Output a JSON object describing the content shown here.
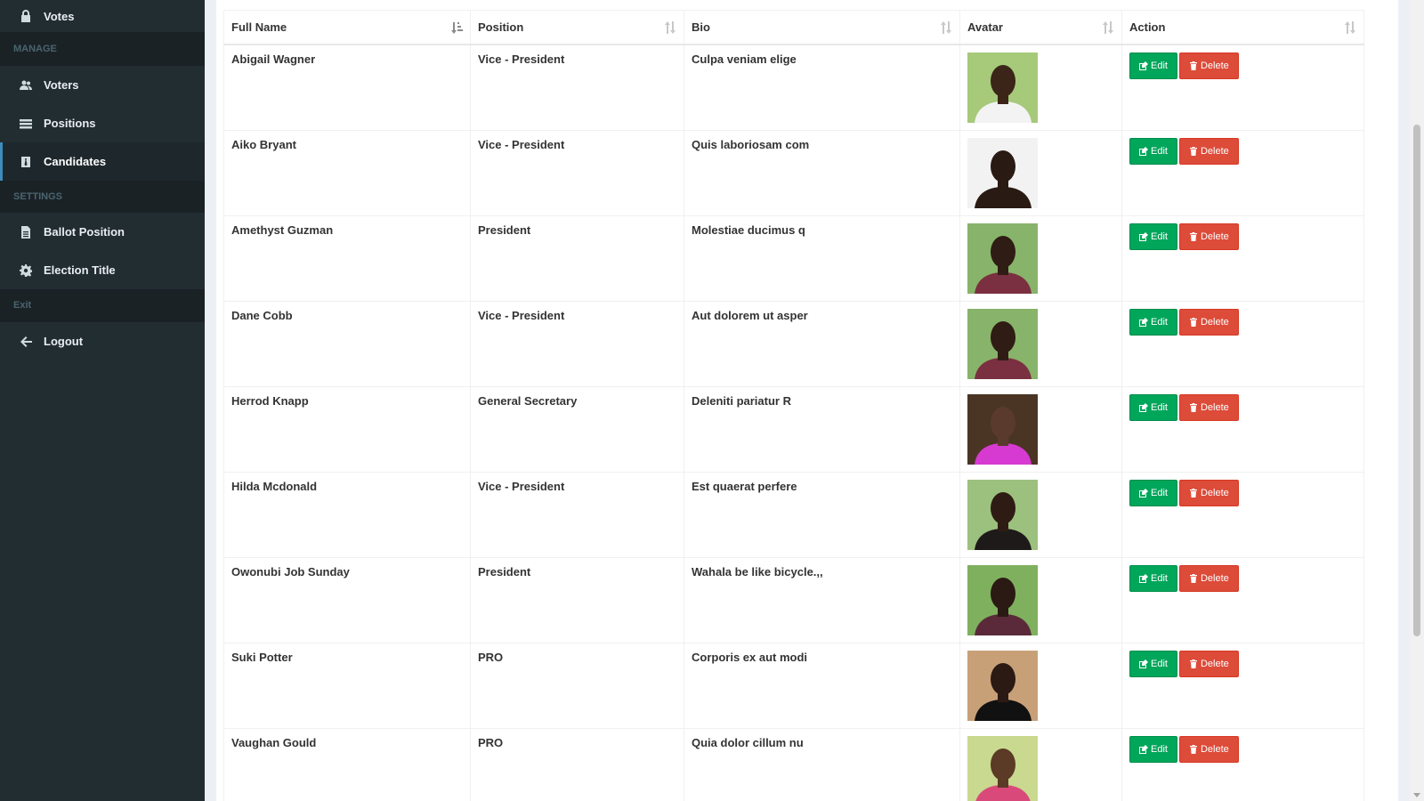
{
  "sidebar": {
    "top_item": {
      "label": "Votes",
      "icon": "lock-icon"
    },
    "sections": [
      {
        "header": "MANAGE",
        "items": [
          {
            "label": "Voters",
            "icon": "users-icon",
            "active": false
          },
          {
            "label": "Positions",
            "icon": "tasks-icon",
            "active": false
          },
          {
            "label": "Candidates",
            "icon": "black-tie-icon",
            "active": true
          }
        ]
      },
      {
        "header": "SETTINGS",
        "items": [
          {
            "label": "Ballot Position",
            "icon": "file-text-icon",
            "active": false
          },
          {
            "label": "Election Title",
            "icon": "cog-icon",
            "active": false
          }
        ]
      },
      {
        "header": "Exit",
        "items": [
          {
            "label": "Logout",
            "icon": "arrow-left-icon",
            "active": false
          }
        ]
      }
    ]
  },
  "table": {
    "columns": [
      "Full Name",
      "Position",
      "Bio",
      "Avatar",
      "Action"
    ],
    "edit_label": "Edit",
    "delete_label": "Delete",
    "rows": [
      {
        "name": "Abigail Wagner",
        "position": "Vice - President",
        "bio": "Culpa veniam elige"
      },
      {
        "name": "Aiko Bryant",
        "position": "Vice - President",
        "bio": "Quis laboriosam com"
      },
      {
        "name": "Amethyst Guzman",
        "position": "President",
        "bio": "Molestiae ducimus q"
      },
      {
        "name": "Dane Cobb",
        "position": "Vice - President",
        "bio": "Aut dolorem ut asper"
      },
      {
        "name": "Herrod Knapp",
        "position": "General Secretary",
        "bio": "Deleniti pariatur R"
      },
      {
        "name": "Hilda Mcdonald",
        "position": "Vice - President",
        "bio": "Est quaerat perfere"
      },
      {
        "name": "Owonubi Job Sunday",
        "position": "President",
        "bio": "Wahala be like bicycle.,,"
      },
      {
        "name": "Suki Potter",
        "position": "PRO",
        "bio": "Corporis ex aut modi"
      },
      {
        "name": "Vaughan Gould",
        "position": "PRO",
        "bio": "Quia dolor cillum nu"
      }
    ]
  },
  "colors": {
    "sidebar_bg": "#222d32",
    "edit_button": "#00a65a",
    "delete_button": "#dd4b39",
    "active_accent": "#3c8dbc"
  }
}
